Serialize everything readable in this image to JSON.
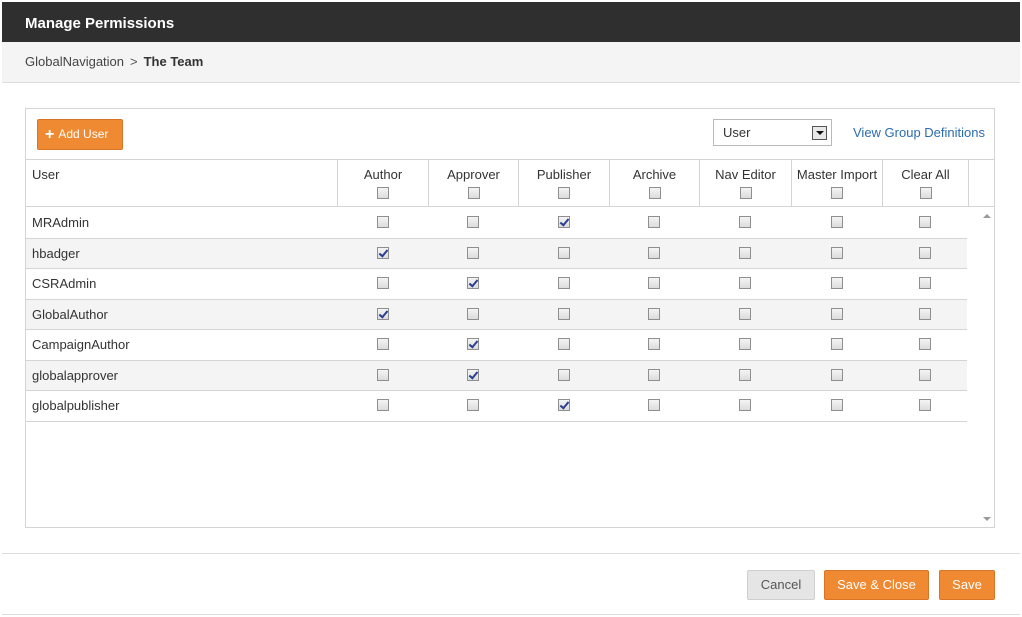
{
  "dialog": {
    "title": "Manage Permissions"
  },
  "breadcrumb": {
    "parent": "GlobalNavigation",
    "separator": ">",
    "current": "The Team"
  },
  "toolbar": {
    "add_user_label": "Add User",
    "type_select_value": "User",
    "view_groups_link": "View Group Definitions"
  },
  "table": {
    "columns": [
      "User",
      "Author",
      "Approver",
      "Publisher",
      "Archive",
      "Nav Editor",
      "Master Import",
      "Clear All"
    ],
    "rows": [
      {
        "user": "MRAdmin",
        "perms": [
          false,
          false,
          true,
          false,
          false,
          false,
          false
        ]
      },
      {
        "user": "hbadger",
        "perms": [
          true,
          false,
          false,
          false,
          false,
          false,
          false
        ]
      },
      {
        "user": "CSRAdmin",
        "perms": [
          false,
          true,
          false,
          false,
          false,
          false,
          false
        ]
      },
      {
        "user": "GlobalAuthor",
        "perms": [
          true,
          false,
          false,
          false,
          false,
          false,
          false
        ]
      },
      {
        "user": "CampaignAuthor",
        "perms": [
          false,
          true,
          false,
          false,
          false,
          false,
          false
        ]
      },
      {
        "user": "globalapprover",
        "perms": [
          false,
          true,
          false,
          false,
          false,
          false,
          false
        ]
      },
      {
        "user": "globalpublisher",
        "perms": [
          false,
          false,
          true,
          false,
          false,
          false,
          false
        ]
      }
    ]
  },
  "footer": {
    "cancel_label": "Cancel",
    "save_close_label": "Save & Close",
    "save_label": "Save"
  },
  "colors": {
    "accent": "#f08a32",
    "titlebar": "#2f2f2f",
    "link": "#2b6cb0"
  }
}
